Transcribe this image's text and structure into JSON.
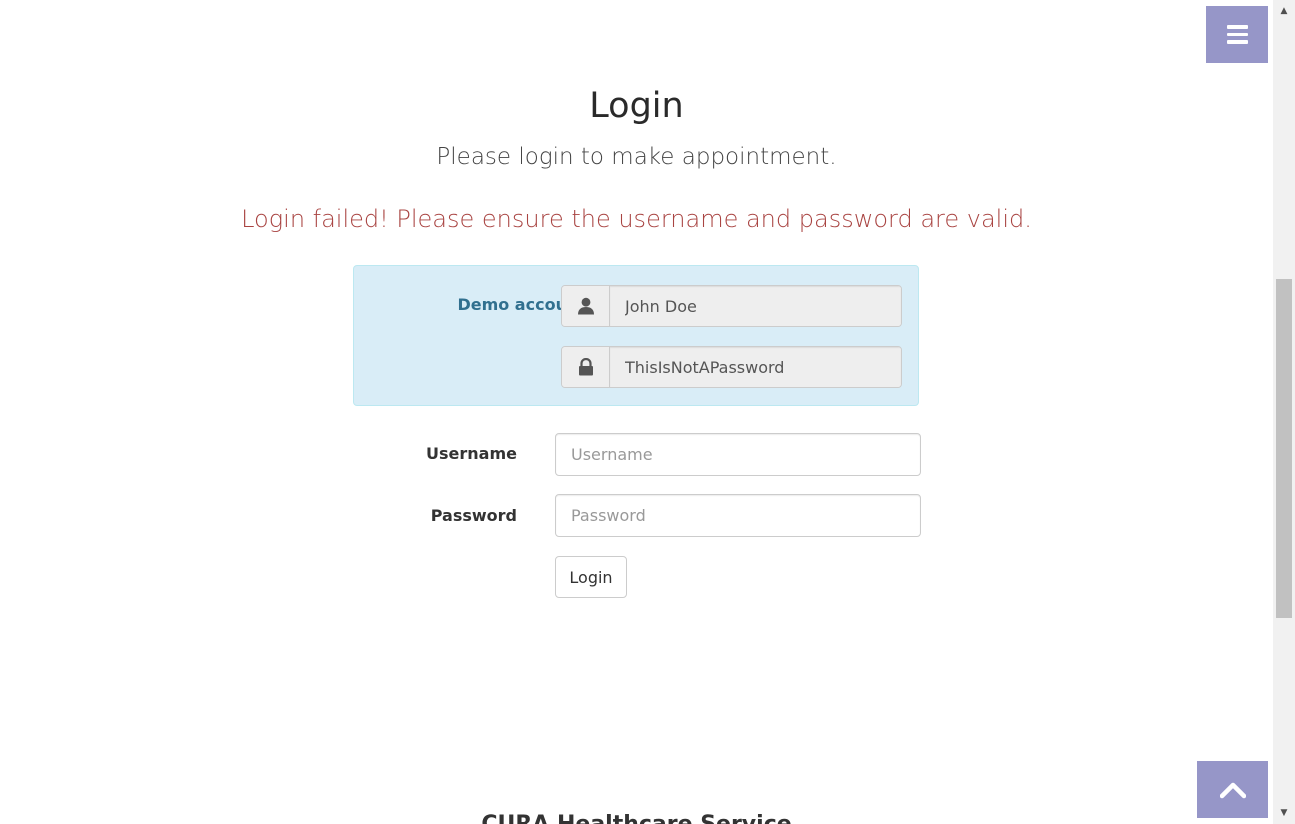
{
  "header": {
    "menu_toggle_icon": "hamburger-menu-icon"
  },
  "login": {
    "title": "Login",
    "subtitle": "Please login to make appointment.",
    "error": "Login failed! Please ensure the username and password are valid."
  },
  "demo": {
    "label": "Demo account",
    "username_value": "John Doe",
    "password_value": "ThisIsNotAPassword",
    "user_icon": "user-icon",
    "lock_icon": "lock-icon"
  },
  "form": {
    "username_label": "Username",
    "username_placeholder": "Username",
    "password_label": "Password",
    "password_placeholder": "Password",
    "login_button": "Login"
  },
  "footer": {
    "heading": "CURA Healthcare Service"
  },
  "colors": {
    "accent": "#9696c8",
    "error": "#a94442",
    "info_bg": "#d9edf7",
    "info_text": "#31708f"
  }
}
